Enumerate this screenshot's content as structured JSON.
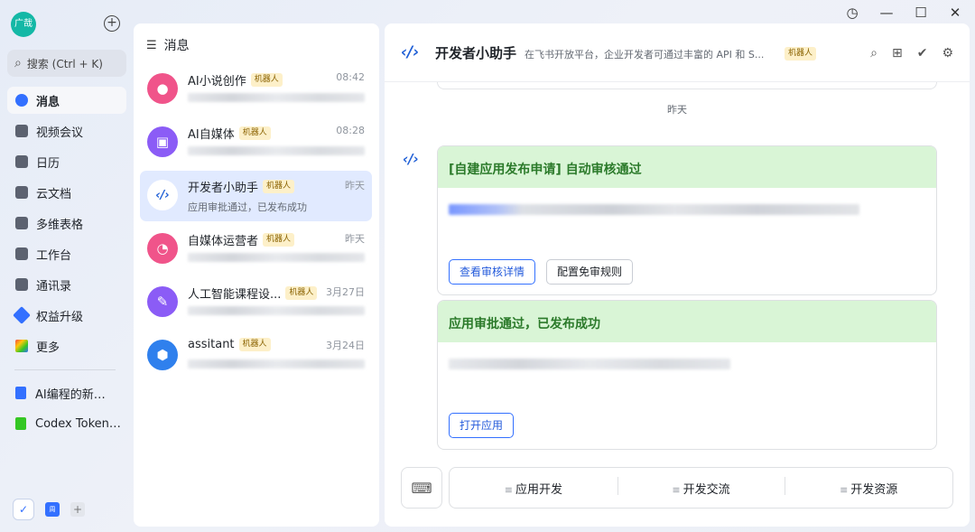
{
  "window": {
    "history_icon": "history-icon",
    "min": "—",
    "max": "☐",
    "close": "✕"
  },
  "sidebar": {
    "avatar_text": "广哉",
    "search_placeholder": "搜索 (Ctrl + K)",
    "nav": [
      {
        "label": "消息",
        "icon": "message-icon",
        "active": true
      },
      {
        "label": "视频会议",
        "icon": "video-icon"
      },
      {
        "label": "日历",
        "icon": "calendar-icon"
      },
      {
        "label": "云文档",
        "icon": "cloud-doc-icon"
      },
      {
        "label": "多维表格",
        "icon": "base-icon"
      },
      {
        "label": "工作台",
        "icon": "workplace-icon"
      },
      {
        "label": "通讯录",
        "icon": "contacts-icon"
      },
      {
        "label": "权益升级",
        "icon": "upgrade-icon"
      },
      {
        "label": "更多",
        "icon": "more-icon"
      }
    ],
    "docs": [
      {
        "label": "AI编程的新…",
        "color": "#3370ff"
      },
      {
        "label": "Codex Token…",
        "color": "#34c724"
      }
    ],
    "bottom_doc_label": "周"
  },
  "chatlist": {
    "title": "消息",
    "chats": [
      {
        "name": "AI小说创作",
        "tag": "机器人",
        "time": "08:42",
        "color": "#f0548a",
        "glyph": "👥",
        "preview": ""
      },
      {
        "name": "AI自媒体",
        "tag": "机器人",
        "time": "08:28",
        "color": "#8b5cf6",
        "glyph": "🤖",
        "preview": ""
      },
      {
        "name": "开发者小助手",
        "tag": "机器人",
        "time": "昨天",
        "color": "#ffffff",
        "glyph": "</>",
        "preview": "应用审批通过，已发布成功"
      },
      {
        "name": "自媒体运营者",
        "tag": "机器人",
        "time": "昨天",
        "color": "#f0548a",
        "glyph": "◔",
        "preview": ""
      },
      {
        "name": "人工智能课程设...",
        "tag": "机器人",
        "time": "3月27日",
        "color": "#8b5cf6",
        "glyph": "🔧",
        "preview": ""
      },
      {
        "name": "assitant",
        "tag": "机器人",
        "time": "3月24日",
        "color": "#2f80ed",
        "glyph": "⬢",
        "preview": ""
      }
    ]
  },
  "main": {
    "title": "开发者小助手",
    "description": "在飞书开放平台，企业开发者可通过丰富的 API 和 S...",
    "tag": "机器人",
    "day_separator": "昨天",
    "card1": {
      "title": "[自建应用发布申请] 自动审核通过",
      "btn_primary": "查看审核详情",
      "btn_secondary": "配置免审规则"
    },
    "card2": {
      "title": "应用审批通过，已发布成功",
      "btn_primary": "打开应用"
    },
    "quick_actions": [
      "应用开发",
      "开发交流",
      "开发资源"
    ]
  }
}
